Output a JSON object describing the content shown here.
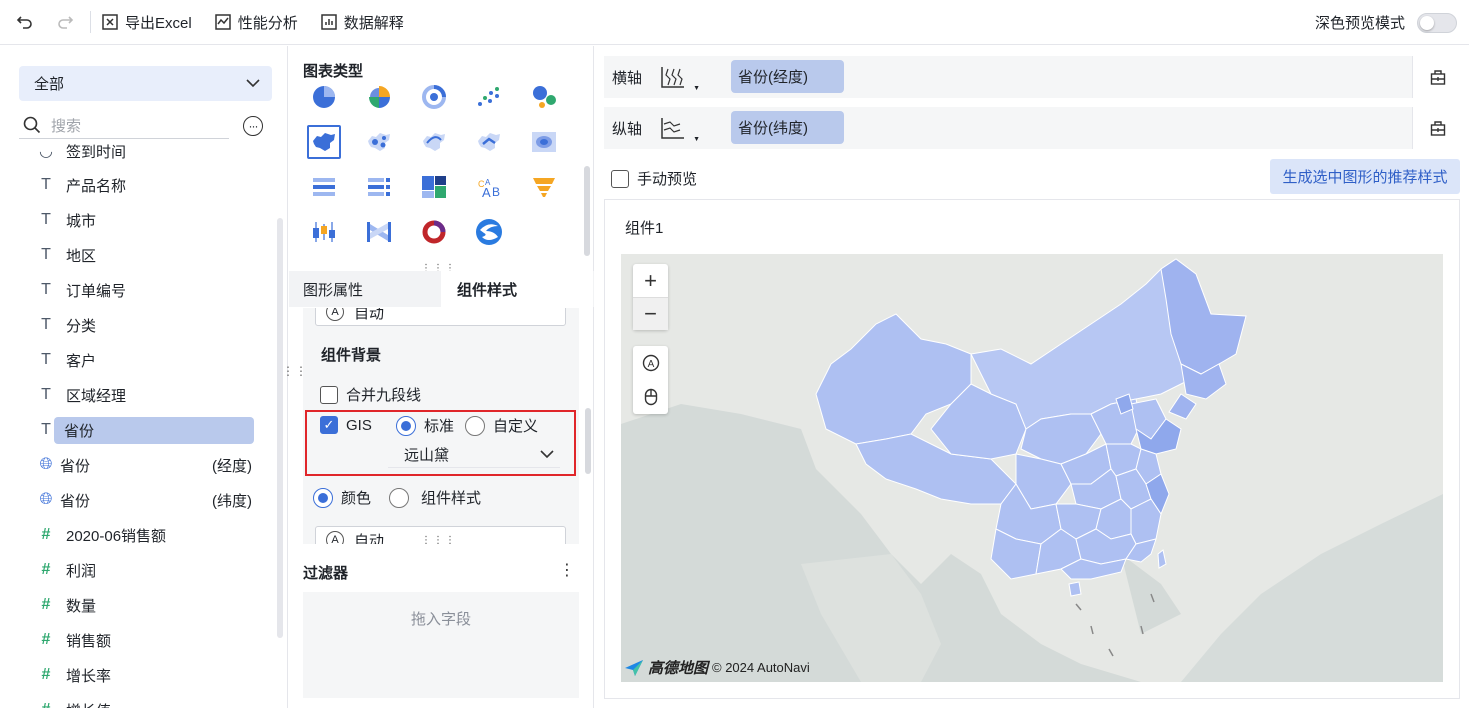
{
  "toolbar": {
    "undo_icon": "undo-icon",
    "redo_icon": "redo-icon",
    "export_excel": "导出Excel",
    "performance": "性能分析",
    "data_explain": "数据解释",
    "dark_mode_label": "深色预览模式",
    "dark_mode_on": false
  },
  "left": {
    "dropdown_value": "全部",
    "search_placeholder": "搜索",
    "fields": [
      {
        "type": "date",
        "label": "签到时间"
      },
      {
        "type": "text",
        "label": "产品名称"
      },
      {
        "type": "text",
        "label": "城市"
      },
      {
        "type": "text",
        "label": "地区"
      },
      {
        "type": "text",
        "label": "订单编号"
      },
      {
        "type": "text",
        "label": "分类"
      },
      {
        "type": "text",
        "label": "客户"
      },
      {
        "type": "text",
        "label": "区域经理"
      },
      {
        "type": "text",
        "label": "省份",
        "selected": true
      },
      {
        "type": "geo",
        "label": "省份",
        "sub": "(经度)"
      },
      {
        "type": "geo",
        "label": "省份",
        "sub": "(纬度)"
      },
      {
        "type": "number",
        "label": "2020-06销售额"
      },
      {
        "type": "number",
        "label": "利润"
      },
      {
        "type": "number",
        "label": "数量"
      },
      {
        "type": "number",
        "label": "销售额"
      },
      {
        "type": "number",
        "label": "增长率"
      },
      {
        "type": "number",
        "label": "增长值"
      }
    ]
  },
  "middle": {
    "chart_types_title": "图表类型",
    "chart_type_icons": [
      "pie-chart-icon",
      "rose-chart-icon",
      "ring-chart-icon",
      "scatter-chart-icon",
      "bubble-chart-icon",
      "map-chart-icon",
      "dot-map-icon",
      "flow-map-icon",
      "heat-dot-map-icon",
      "heat-map-icon",
      "ranking-list-icon",
      "number-list-icon",
      "treemap-icon",
      "word-cloud-icon",
      "funnel-chart-icon",
      "candlestick-chart-icon",
      "sankey-chart-icon",
      "gauge-ring-icon",
      "globe-chart-icon"
    ],
    "selected_chart_type": "map-chart-icon",
    "tabs": [
      "图形属性",
      "组件样式"
    ],
    "active_tab": "组件样式",
    "top_auto": "自动",
    "bg_title": "组件背景",
    "merge_nine_dash": "合并九段线",
    "merge_checked": false,
    "gis_label": "GIS",
    "gis_checked": true,
    "radio_standard": "标准",
    "radio_custom": "自定义",
    "gis_style": "远山黛",
    "color_option": "颜色",
    "component_style_option": "组件样式",
    "bottom_auto": "自动",
    "filter_title": "过滤器",
    "drop_placeholder": "拖入字段"
  },
  "right": {
    "x_axis_label": "横轴",
    "x_axis_field": "省份(经度)",
    "y_axis_label": "纵轴",
    "y_axis_field": "省份(纬度)",
    "manual_preview": "手动预览",
    "recommend_button": "生成选中图形的推荐样式",
    "component_title": "组件1",
    "map_attribution_brand": "高德地图",
    "map_attribution": "© 2024 AutoNavi",
    "colors": {
      "accent": "#3b6fd8",
      "region_fill": "#aec0f2",
      "region_dark": "#8fa8ec",
      "highlight_box": "#e0262a"
    }
  }
}
